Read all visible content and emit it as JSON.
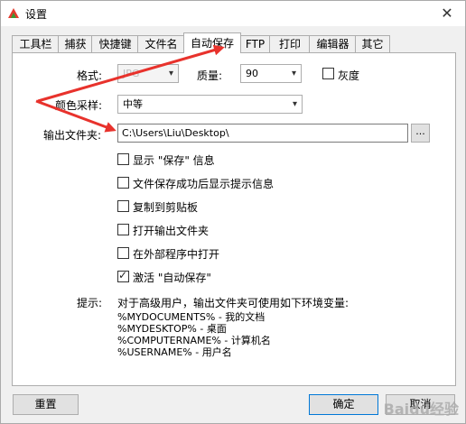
{
  "window": {
    "title": "设置"
  },
  "tabs": [
    {
      "label": "工具栏"
    },
    {
      "label": "捕获"
    },
    {
      "label": "快捷键"
    },
    {
      "label": "文件名"
    },
    {
      "label": "自动保存",
      "active": true
    },
    {
      "label": "FTP"
    },
    {
      "label": "打印"
    },
    {
      "label": "编辑器"
    },
    {
      "label": "其它"
    }
  ],
  "format": {
    "label": "格式:",
    "value": "JPG"
  },
  "quality": {
    "label": "质量:",
    "value": "90"
  },
  "grayscale": {
    "label": "灰度",
    "checked": false
  },
  "color_sampling": {
    "label": "颜色采样:",
    "value": "中等"
  },
  "output_folder": {
    "label": "输出文件夹:",
    "value": "C:\\Users\\Liu\\Desktop\\",
    "browse_label": "..."
  },
  "options": [
    {
      "label": "显示 \"保存\" 信息",
      "checked": false
    },
    {
      "label": "文件保存成功后显示提示信息",
      "checked": false
    },
    {
      "label": "复制到剪贴板",
      "checked": false
    },
    {
      "label": "打开输出文件夹",
      "checked": false
    },
    {
      "label": "在外部程序中打开",
      "checked": false
    },
    {
      "label": "激活 \"自动保存\"",
      "checked": true
    }
  ],
  "hint": {
    "label": "提示:",
    "text": "对于高级用户，输出文件夹可使用如下环境变量:",
    "vars": [
      "%MYDOCUMENTS% - 我的文档",
      "%MYDESKTOP% - 桌面",
      "%COMPUTERNAME% - 计算机名",
      "%USERNAME% - 用户名"
    ]
  },
  "buttons": {
    "reset": "重置",
    "ok": "确定",
    "cancel": "取消"
  },
  "watermark": "Baidu经验",
  "colors": {
    "annotation_arrow": "#e8322c",
    "focus_border": "#0078d7"
  }
}
